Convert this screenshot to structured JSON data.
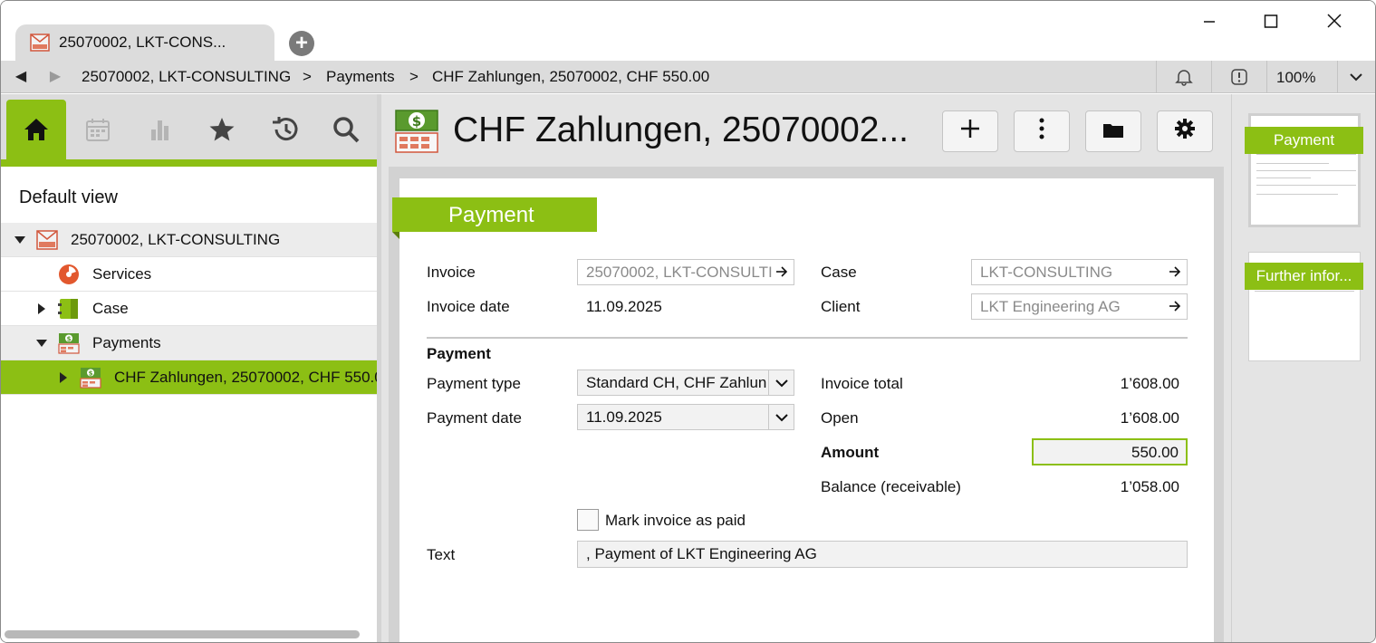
{
  "titlebar": {
    "tab_title": "25070002, LKT-CONS...",
    "new_tab": "+"
  },
  "navbar": {
    "back": "◀",
    "forward": "▶",
    "breadcrumbs": [
      "25070002, LKT-CONSULTING",
      "Payments",
      "CHF Zahlungen, 25070002, CHF 550.00"
    ],
    "separator": ">",
    "zoom": "100%"
  },
  "left": {
    "view_title": "Default view",
    "tree": [
      {
        "label": "25070002, LKT-CONSULTING",
        "icon": "invoice-icon",
        "expanded": true
      },
      {
        "label": "Services",
        "icon": "services-icon"
      },
      {
        "label": "Case",
        "icon": "case-icon",
        "expanded": false
      },
      {
        "label": "Payments",
        "icon": "payments-icon",
        "expanded": true
      },
      {
        "label": "CHF Zahlungen, 25070002, CHF 550.00",
        "icon": "payment-icon",
        "expanded": false
      }
    ]
  },
  "main": {
    "title": "CHF Zahlungen, 25070002...",
    "section_label": "Payment",
    "invoice_label": "Invoice",
    "invoice_value": "25070002, LKT-CONSULTI",
    "invoice_date_label": "Invoice date",
    "invoice_date_value": "11.09.2025",
    "case_label": "Case",
    "case_value": "LKT-CONSULTING",
    "client_label": "Client",
    "client_value": "LKT Engineering AG",
    "payment_heading": "Payment",
    "payment_type_label": "Payment type",
    "payment_type_value": "Standard CH, CHF Zahlun",
    "payment_date_label": "Payment date",
    "payment_date_value": "11.09.2025",
    "invoice_total_label": "Invoice total",
    "invoice_total_value": "1’608.00",
    "open_label": "Open",
    "open_value": "1’608.00",
    "amount_label": "Amount",
    "amount_value": "550.00",
    "balance_label": "Balance (receivable)",
    "balance_value": "1’058.00",
    "mark_paid_label": "Mark invoice as paid",
    "text_label": "Text",
    "text_value": ", Payment of LKT Engineering AG"
  },
  "right": {
    "thumb1_label": "Payment",
    "thumb2_label": "Further infor..."
  },
  "colors": {
    "accent": "#8cbf14",
    "chrome": "#dcdcdc"
  }
}
